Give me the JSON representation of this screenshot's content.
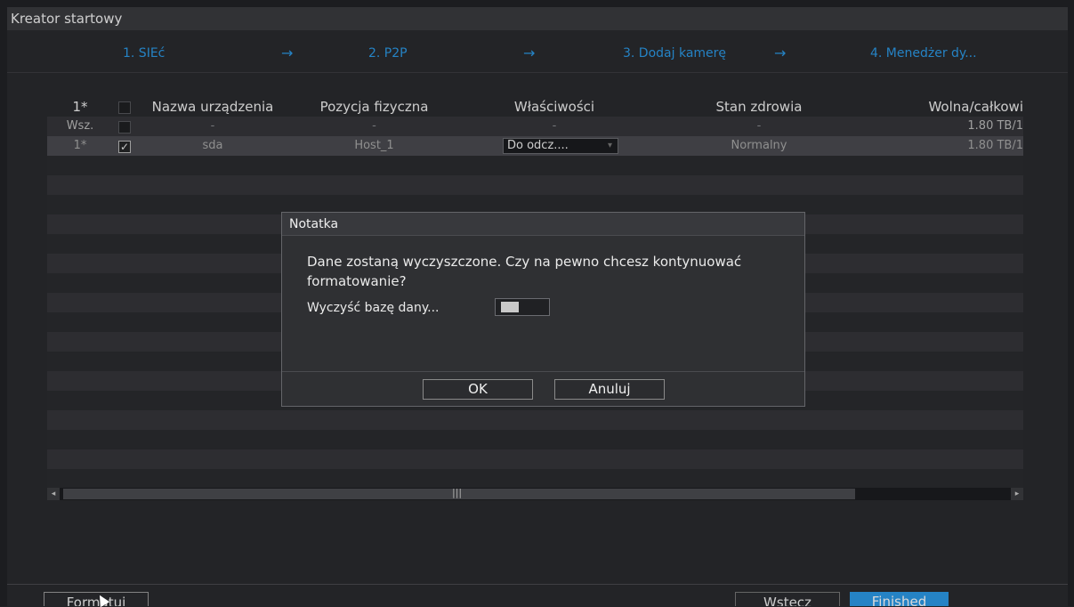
{
  "window": {
    "title": "Kreator startowy"
  },
  "steps": [
    {
      "label": "1. SIEć"
    },
    {
      "label": "2. P2P"
    },
    {
      "label": "3. Dodaj kamerę"
    },
    {
      "label": "4. Menedżer dy..."
    }
  ],
  "step_arrow": "→",
  "table": {
    "headers": {
      "num": "1*",
      "name": "Nazwa urządzenia",
      "position": "Pozycja fizyczna",
      "properties": "Właściwości",
      "health": "Stan zdrowia",
      "free_total": "Wolna/całkowi"
    },
    "all_row": {
      "num": "Wsz.",
      "name": "-",
      "position": "-",
      "properties": "-",
      "health": "-",
      "free_total": "1.80 TB/1"
    },
    "rows": [
      {
        "num": "1*",
        "checked": true,
        "name": "sda",
        "position": "Host_1",
        "properties": "Do odcz....",
        "health": "Normalny",
        "free_total": "1.80 TB/1"
      }
    ]
  },
  "dialog": {
    "title": "Notatka",
    "message": "Dane zostaną wyczyszczone. Czy na pewno chcesz kontynuować formatowanie?",
    "option_label": "Wyczyść bazę dany...",
    "ok_label": "OK",
    "cancel_label": "Anuluj"
  },
  "bottom": {
    "format_label": "Formatuj",
    "back_label": "Wstecz",
    "finish_label": "Finished"
  },
  "colors": {
    "accent": "#2c9ae8"
  },
  "icons": {
    "checkbox_checked": "✓",
    "dropdown": "▾",
    "scroll_left": "◂",
    "scroll_right": "▸",
    "scroll_grip": "|||"
  }
}
